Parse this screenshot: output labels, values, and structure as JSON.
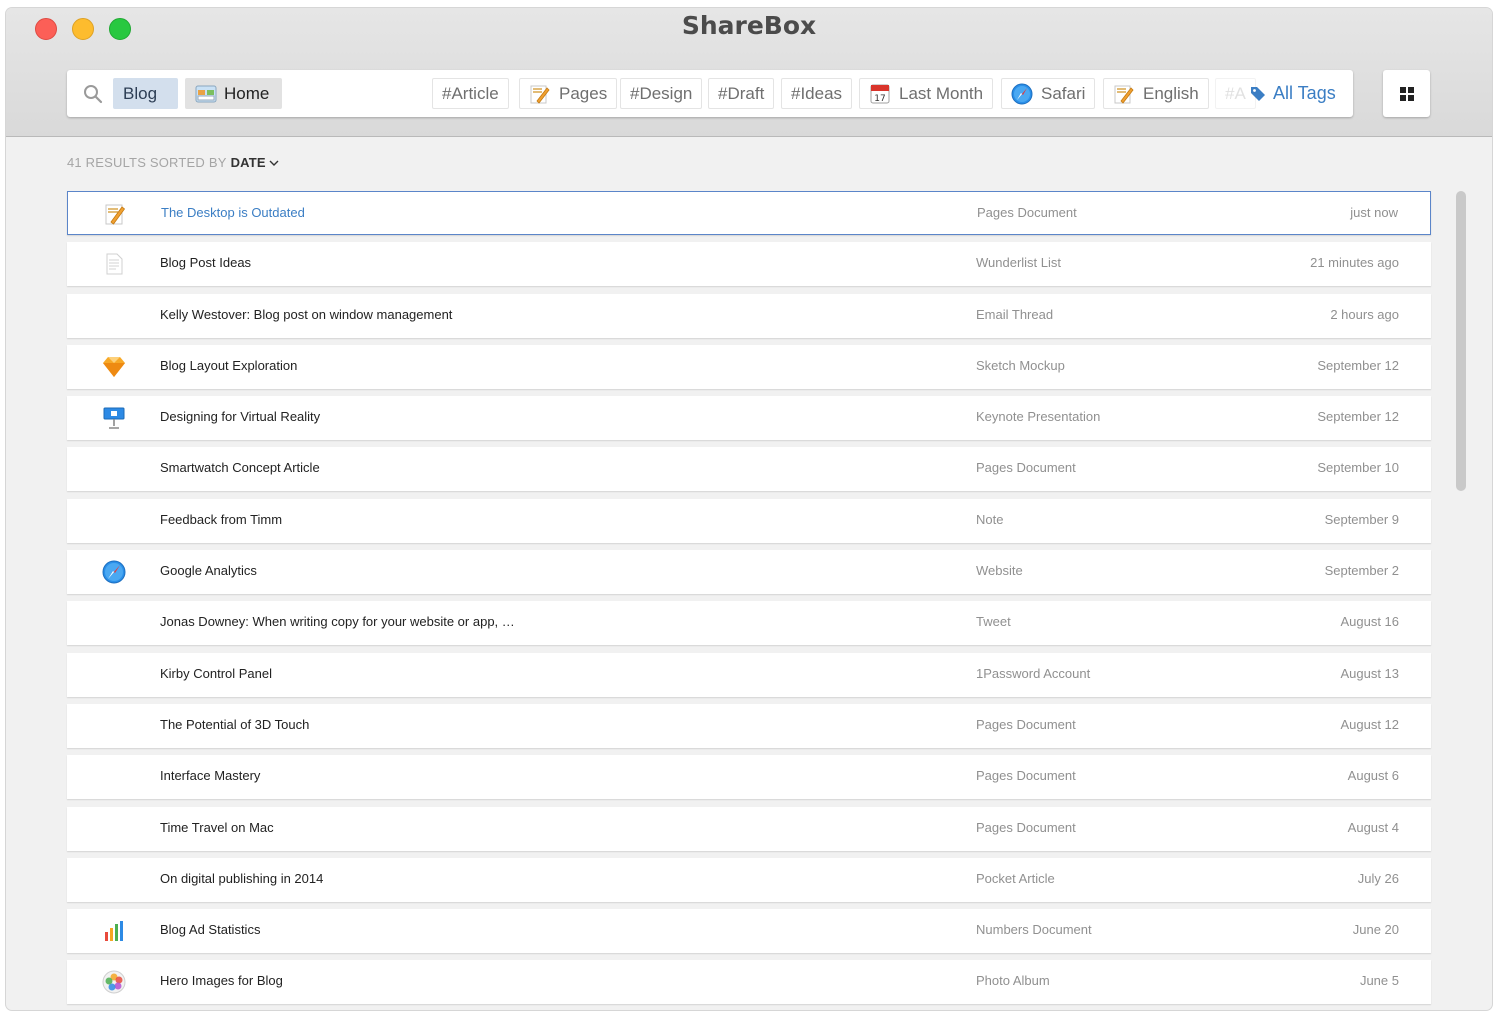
{
  "app": {
    "title": "ShareBox"
  },
  "search": {
    "tokens": [
      "Blog",
      "Home"
    ],
    "tags": [
      "#Article",
      "Pages",
      "#Design",
      "#Draft",
      "#Ideas",
      "Last Month",
      "Safari",
      "English",
      "#A"
    ],
    "all_tags_label": "All Tags"
  },
  "sort": {
    "prefix": "41 RESULTS SORTED BY",
    "key": "DATE"
  },
  "items": [
    {
      "title": "The Desktop is Outdated",
      "type": "Pages Document",
      "date": "just now",
      "icon": "pages-icon"
    },
    {
      "title": "Blog Post Ideas",
      "type": "Wunderlist List",
      "date": "21 minutes ago",
      "icon": "document-icon"
    },
    {
      "title": "Kelly Westover: Blog post on window management",
      "type": "Email Thread",
      "date": "2 hours ago",
      "icon": ""
    },
    {
      "title": "Blog Layout Exploration",
      "type": "Sketch Mockup",
      "date": "September 12",
      "icon": "sketch-icon"
    },
    {
      "title": "Designing for Virtual Reality",
      "type": "Keynote Presentation",
      "date": "September 12",
      "icon": "keynote-icon"
    },
    {
      "title": "Smartwatch Concept Article",
      "type": "Pages Document",
      "date": "September 10",
      "icon": ""
    },
    {
      "title": "Feedback from Timm",
      "type": "Note",
      "date": "September 9",
      "icon": ""
    },
    {
      "title": "Google Analytics",
      "type": "Website",
      "date": "September 2",
      "icon": "safari-icon"
    },
    {
      "title": "Jonas Downey: When writing copy for your website or app, …",
      "type": "Tweet",
      "date": "August 16",
      "icon": ""
    },
    {
      "title": "Kirby Control Panel",
      "type": "1Password Account",
      "date": "August 13",
      "icon": ""
    },
    {
      "title": "The Potential of 3D Touch",
      "type": "Pages Document",
      "date": "August 12",
      "icon": ""
    },
    {
      "title": "Interface Mastery",
      "type": "Pages Document",
      "date": "August 6",
      "icon": ""
    },
    {
      "title": "Time Travel on Mac",
      "type": "Pages Document",
      "date": "August 4",
      "icon": ""
    },
    {
      "title": "On digital publishing in 2014",
      "type": "Pocket Article",
      "date": "July 26",
      "icon": ""
    },
    {
      "title": "Blog Ad Statistics",
      "type": "Numbers Document",
      "date": "June 20",
      "icon": "numbers-icon"
    },
    {
      "title": "Hero Images for Blog",
      "type": "Photo Album",
      "date": "June 5",
      "icon": "photos-icon"
    }
  ],
  "colors": {
    "accent": "#3b7ec4",
    "selected_border": "#5b85c9",
    "token_blog_bg": "#d3dfed"
  }
}
